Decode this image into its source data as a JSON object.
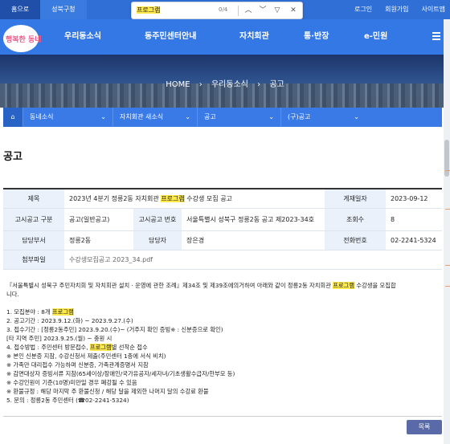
{
  "topbar": {
    "tab_home": "홈으로",
    "tab_seongbuk": "성북구청",
    "util": [
      "로그인",
      "회원가입",
      "사이트맵"
    ]
  },
  "findbar": {
    "query": "프로그램",
    "count": "0/4",
    "up_icon": "chevron-up-icon",
    "down_icon": "chevron-down-icon",
    "filter_icon": "filter-icon",
    "close_icon": "close-icon"
  },
  "header": {
    "logo_text": "행복한 동네",
    "nav": [
      "우리동소식",
      "동주민센터안내",
      "자치회관",
      "통·반장",
      "e-민원"
    ]
  },
  "hero": {
    "crumb": [
      "HOME",
      "우리동소식",
      "공고"
    ]
  },
  "subnav": {
    "items": [
      "동네소식",
      "자치회관 새소식",
      "공고",
      "(구)공고"
    ]
  },
  "page_title": "공고",
  "table": {
    "labels": {
      "title": "제목",
      "date": "게재일자",
      "notice_type": "고시공고 구분",
      "notice_no": "고시공고 번호",
      "views": "조회수",
      "dept": "담당부서",
      "person": "담당자",
      "phone": "전화번호",
      "attach": "첨부파일"
    },
    "title_pre": "2023년 4분기 정릉2동 자치회관 ",
    "title_hl": "프로그램",
    "title_post": " 수강생 모집 공고",
    "date": "2023-09-12",
    "notice_type": "공고(일반공고)",
    "notice_no": "서울특별시 성북구 정릉2동 공고 제2023-34호",
    "views": "8",
    "dept": "정릉2동",
    "person": "장은경",
    "phone": "02-2241-5324",
    "attach": "수강생모집공고 2023_34.pdf"
  },
  "body": {
    "intro_pre": "『서울특별시 성북구 주민자치회 및 자치회관 설치 · 운영에 관한 조례』제34조 및 제39조에의거하여 아래와 같이 정릉2동 자치회관 ",
    "intro_hl": "프로그램",
    "intro_post": " 수강생을 모집합",
    "intro_end": "니다.",
    "l1_pre": "1. 모집분야 : 8개 ",
    "l1_hl": "프로그램",
    "l2": "2. 공고기간 : 2023.9.12.(화) ~ 2023.9.27.(수)",
    "l3": "3. 접수기간 : [정릉2동주민] 2023.9.20.(수)~ (거주지 확인 증빙※ : 신분증으로 확인)",
    "l3b": "[타 지역 주민] 2023.9.25.(월) ~ 충원 시",
    "l4_pre": "4. 접수방법 : 주민센터 방문접수, ",
    "l4_hl": "프로그램",
    "l4_post": "별 선착순 접수",
    "n1": "※ 본인 신분증 지참, 수강신청서 제출(주민센터 1층에 서식 비치)",
    "n2": "※ 가족만 대리접수 가능하며 신분증, 가족관계증명서 지참",
    "n3": "※ 감면대상자 증빙서류 지참(65세이상/장애인/국가유공자/세자녀/기초생활수급자/한부모 등)",
    "n4": "※ 수강인원이 기준(10명)미만일 경우 폐강될 수 있음",
    "n5": "※ 환불규정 : 해당 마지막 주 환불신청 / 해당 달을 제외한 나머지 달의 수강료 환불",
    "l5": "5. 문의 : 정릉2동 주민센터 (☎02-2241-5324)"
  },
  "list_button": "목록",
  "colors": {
    "primary": "#3478e6",
    "highlight": "#ffe94a",
    "table_header": "#eaf1fb"
  }
}
